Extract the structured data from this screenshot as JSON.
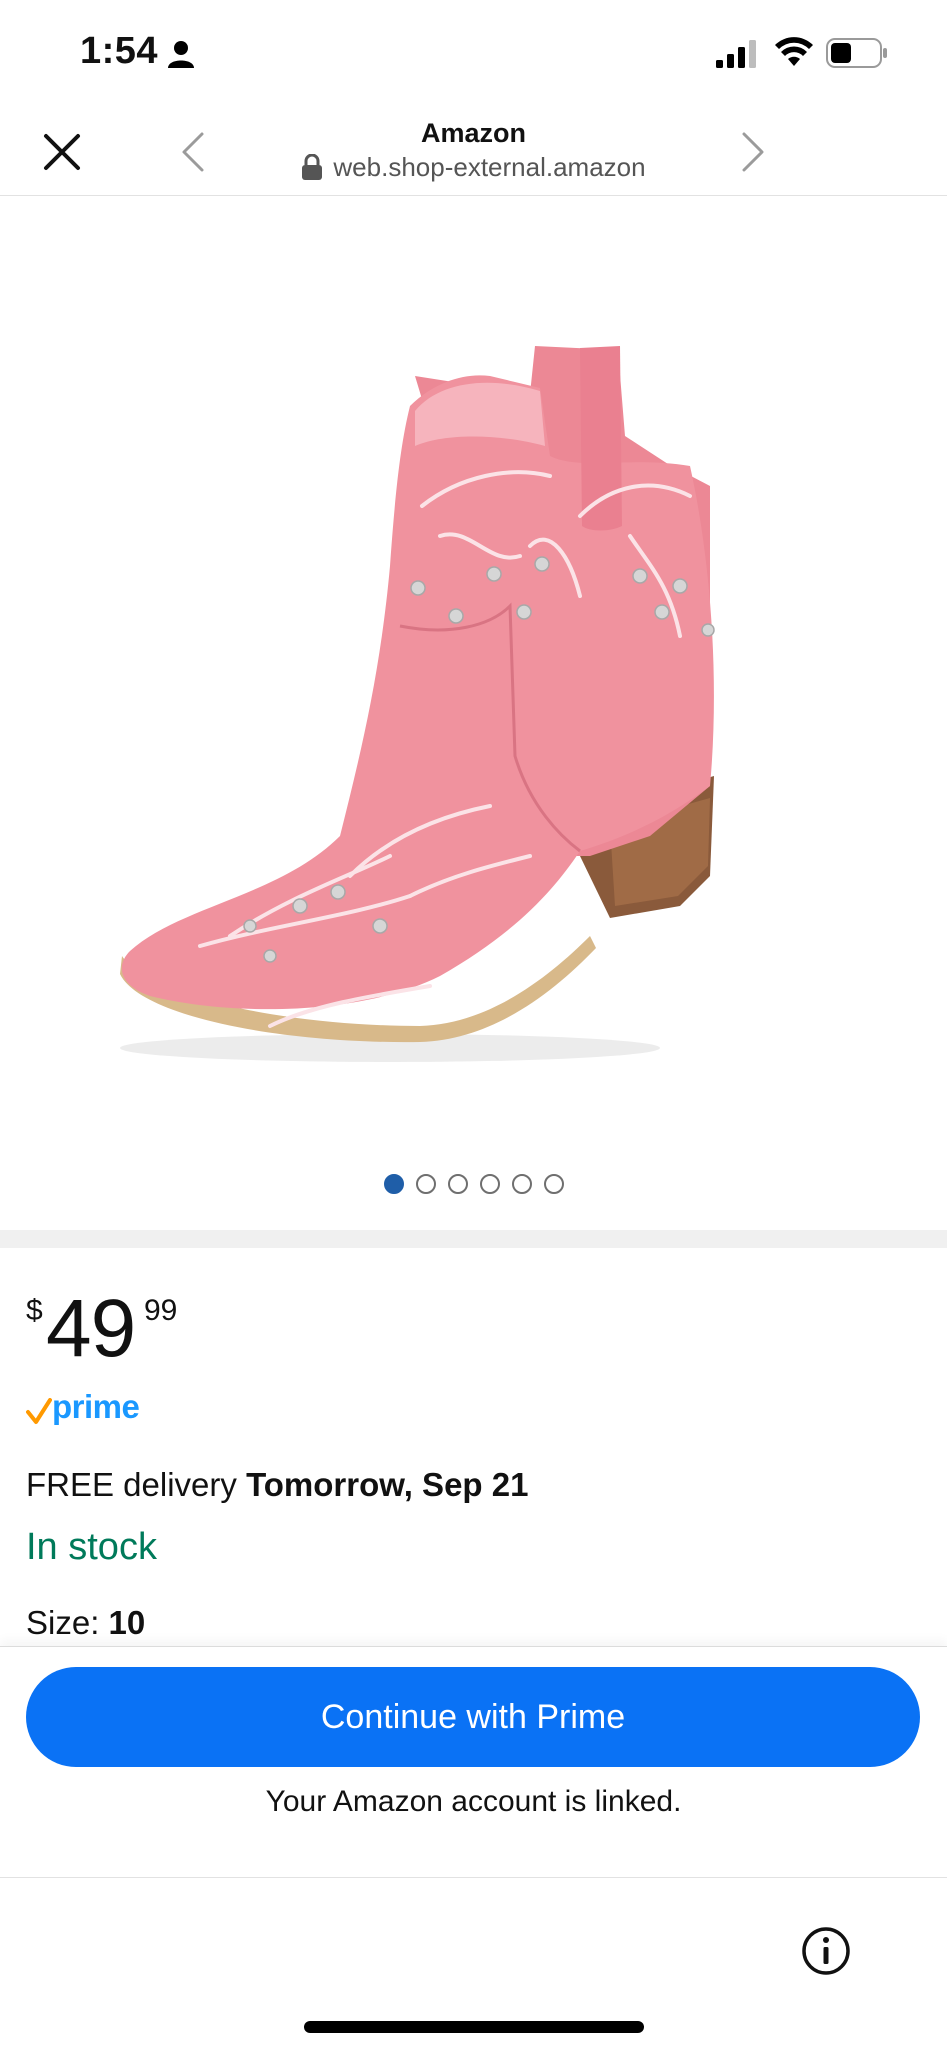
{
  "status_bar": {
    "time": "1:54"
  },
  "browser": {
    "site_title": "Amazon",
    "url": "web.shop-external.amazon"
  },
  "product": {
    "image_name": "pink-embroidered-cowboy-boot",
    "carousel": {
      "total": 6,
      "active": 1
    },
    "price": {
      "symbol": "$",
      "whole": "49",
      "fraction": "99"
    },
    "prime_label": "prime",
    "delivery": {
      "prefix": "FREE delivery ",
      "date": "Tomorrow, Sep 21"
    },
    "stock": "In stock",
    "size": {
      "label": "Size: ",
      "value": "10"
    }
  },
  "bottom_sheet": {
    "cta_label": "Continue with Prime",
    "linked_text": "Your Amazon account is linked."
  },
  "colors": {
    "prime_blue": "#1a98ff",
    "prime_check": "#ff9900",
    "stock_green": "#007a5a",
    "cta_blue": "#0a72f5",
    "dot_active": "#1f5ea8",
    "boot_pink": "#ef8f9c"
  },
  "icons": [
    "person-icon",
    "signal-icon",
    "wifi-icon",
    "battery-icon",
    "close-icon",
    "back-chevron-icon",
    "forward-chevron-icon",
    "lock-icon",
    "prime-check-icon",
    "info-icon"
  ]
}
